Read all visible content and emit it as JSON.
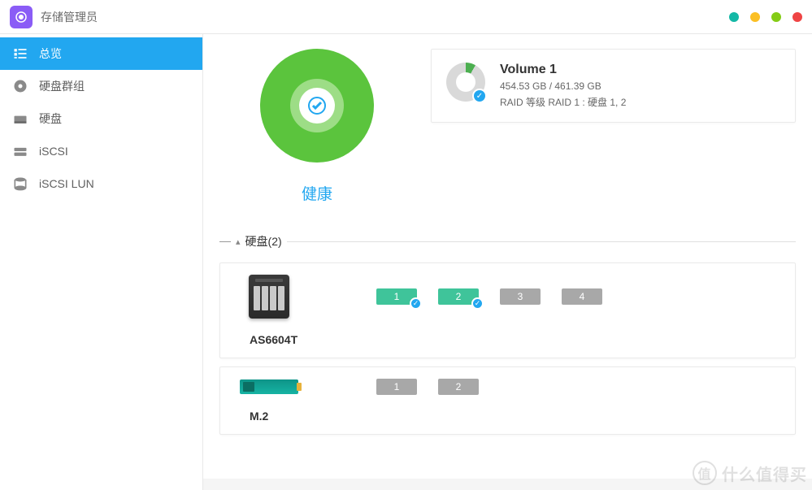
{
  "app": {
    "title": "存储管理员"
  },
  "sidebar": {
    "items": [
      {
        "label": "总览",
        "active": true
      },
      {
        "label": "硬盘群组",
        "active": false
      },
      {
        "label": "硬盘",
        "active": false
      },
      {
        "label": "iSCSI",
        "active": false
      },
      {
        "label": "iSCSI LUN",
        "active": false
      }
    ]
  },
  "health": {
    "label": "健康"
  },
  "volume": {
    "name": "Volume 1",
    "capacity": "454.53 GB / 461.39 GB",
    "raid": "RAID 等级 RAID 1 : 硬盘 1, 2"
  },
  "disks_section": {
    "title": "硬盘(2)"
  },
  "devices": [
    {
      "name": "AS6604T",
      "type": "nas",
      "bays": [
        {
          "num": "1",
          "active": true,
          "check": true
        },
        {
          "num": "2",
          "active": true,
          "check": true
        },
        {
          "num": "3",
          "active": false,
          "check": false
        },
        {
          "num": "4",
          "active": false,
          "check": false
        }
      ]
    },
    {
      "name": "M.2",
      "type": "m2",
      "bays": [
        {
          "num": "1",
          "active": false,
          "check": false
        },
        {
          "num": "2",
          "active": false,
          "check": false
        }
      ]
    }
  ],
  "watermark": {
    "text": "什么值得买"
  }
}
